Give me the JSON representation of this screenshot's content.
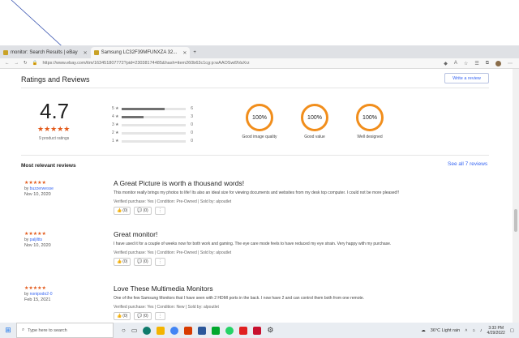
{
  "browser": {
    "tabs": [
      {
        "label": "monitor: Search Results | eBay",
        "active": false
      },
      {
        "label": "Samsung LC32F39MFUNXZA 32...",
        "active": true
      }
    ],
    "new_tab": "+",
    "url": "https://www.ebay.com/itm/163451807772?pid=23038174485&hash=item260b63c1cg:p:wAAOSwt9VaXrz"
  },
  "ratings": {
    "title": "Ratings and Reviews",
    "write_review": "Write a review",
    "average": "4.7",
    "stars": "★★★★★",
    "count_label": "9 product ratings",
    "histogram": [
      {
        "label": "5",
        "count": "6",
        "fraction": 0.667
      },
      {
        "label": "4",
        "count": "3",
        "fraction": 0.333
      },
      {
        "label": "3",
        "count": "0",
        "fraction": 0
      },
      {
        "label": "2",
        "count": "0",
        "fraction": 0
      },
      {
        "label": "1",
        "count": "0",
        "fraction": 0
      }
    ],
    "circles": [
      {
        "value": "100%",
        "label": "Good image quality"
      },
      {
        "value": "100%",
        "label": "Good value"
      },
      {
        "value": "100%",
        "label": "Well designed"
      }
    ]
  },
  "reviews": {
    "title": "Most relevant reviews",
    "see_all": "See all 7 reviews",
    "items": [
      {
        "stars": "★★★★★",
        "by_prefix": "by",
        "author": "buzzerwesse",
        "date": "Nov 10, 2020",
        "title": "A Great Picture is worth a thousand words!",
        "body": "This monitor really brings my photos to life! Its also an ideal size for viewing documents and websites from my desk top computer. I could not be more pleased!!",
        "verified": "Verified purchase: Yes | Condition: Pre-Owned | Sold by: alpoutlet",
        "up": "(0)",
        "down": "(0)"
      },
      {
        "stars": "★★★★★",
        "by_prefix": "by",
        "author": "paljiltts",
        "date": "Nov 10, 2020",
        "title": "Great monitor!",
        "body": "I have used it for a couple of weeks now for both work and gaming. The eye care mode feels to have reduced my eye strain. Very happy with my purchase.",
        "verified": "Verified purchase: Yes | Condition: Pre-Owned | Sold by: alpoutlet",
        "up": "(0)",
        "down": "(0)"
      },
      {
        "stars": "★★★★★",
        "by_prefix": "by",
        "author": "nonipodo2-0",
        "date": "Feb 15, 2021",
        "title": "Love These Multimedia Monitors",
        "body": "One of the few Samsung Monitors that I have seen with 2 HDMI ports in the back. I now have 2 and can control them both from one remote.",
        "verified": "Verified purchase: Yes | Condition: New | Sold by: alpoutlet",
        "up": "(0)",
        "down": "(0)"
      }
    ]
  },
  "taskbar": {
    "search_placeholder": "Type here to search",
    "weather": "36°C  Light rain",
    "time": "3:33 PM",
    "date": "4/29/2022"
  },
  "colors": {
    "star": "#e35a1b",
    "circle": "#f18e1c",
    "link": "#3665f3"
  }
}
